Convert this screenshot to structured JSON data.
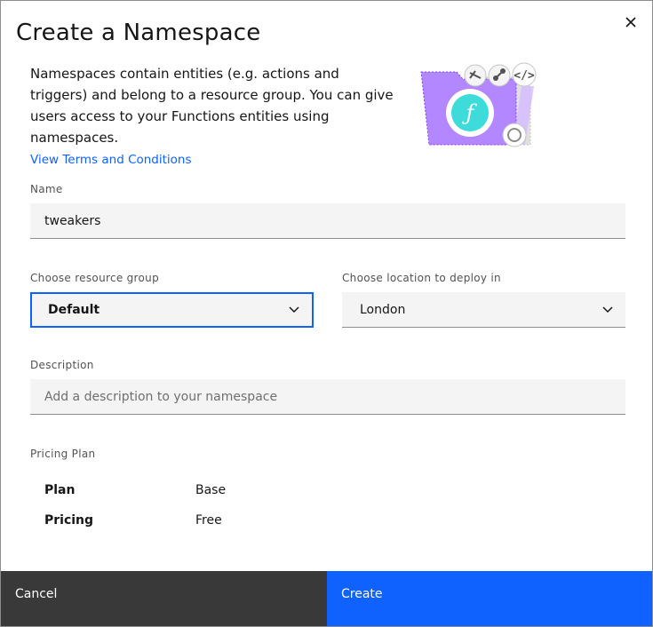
{
  "modal": {
    "title": "Create a Namespace",
    "close_icon": "close-icon"
  },
  "intro": {
    "text": "Namespaces contain entities (e.g. actions and triggers) and belong to a resource group. You can give users access to your Functions entities using namespaces.",
    "terms_link": "View Terms and Conditions"
  },
  "form": {
    "name": {
      "label": "Name",
      "value": "tweakers"
    },
    "resource_group": {
      "label": "Choose resource group",
      "selected": "Default"
    },
    "location": {
      "label": "Choose location to deploy in",
      "selected": "London"
    },
    "description": {
      "label": "Description",
      "value": "",
      "placeholder": "Add a description to your namespace"
    }
  },
  "pricing": {
    "label": "Pricing Plan",
    "rows": [
      {
        "key": "Plan",
        "value": "Base"
      },
      {
        "key": "Pricing",
        "value": "Free"
      }
    ]
  },
  "footer": {
    "cancel_label": "Cancel",
    "create_label": "Create"
  },
  "colors": {
    "primary": "#0f62fe",
    "secondary": "#393939",
    "folder": "#b287ff",
    "logo": "#3ddbd9"
  }
}
